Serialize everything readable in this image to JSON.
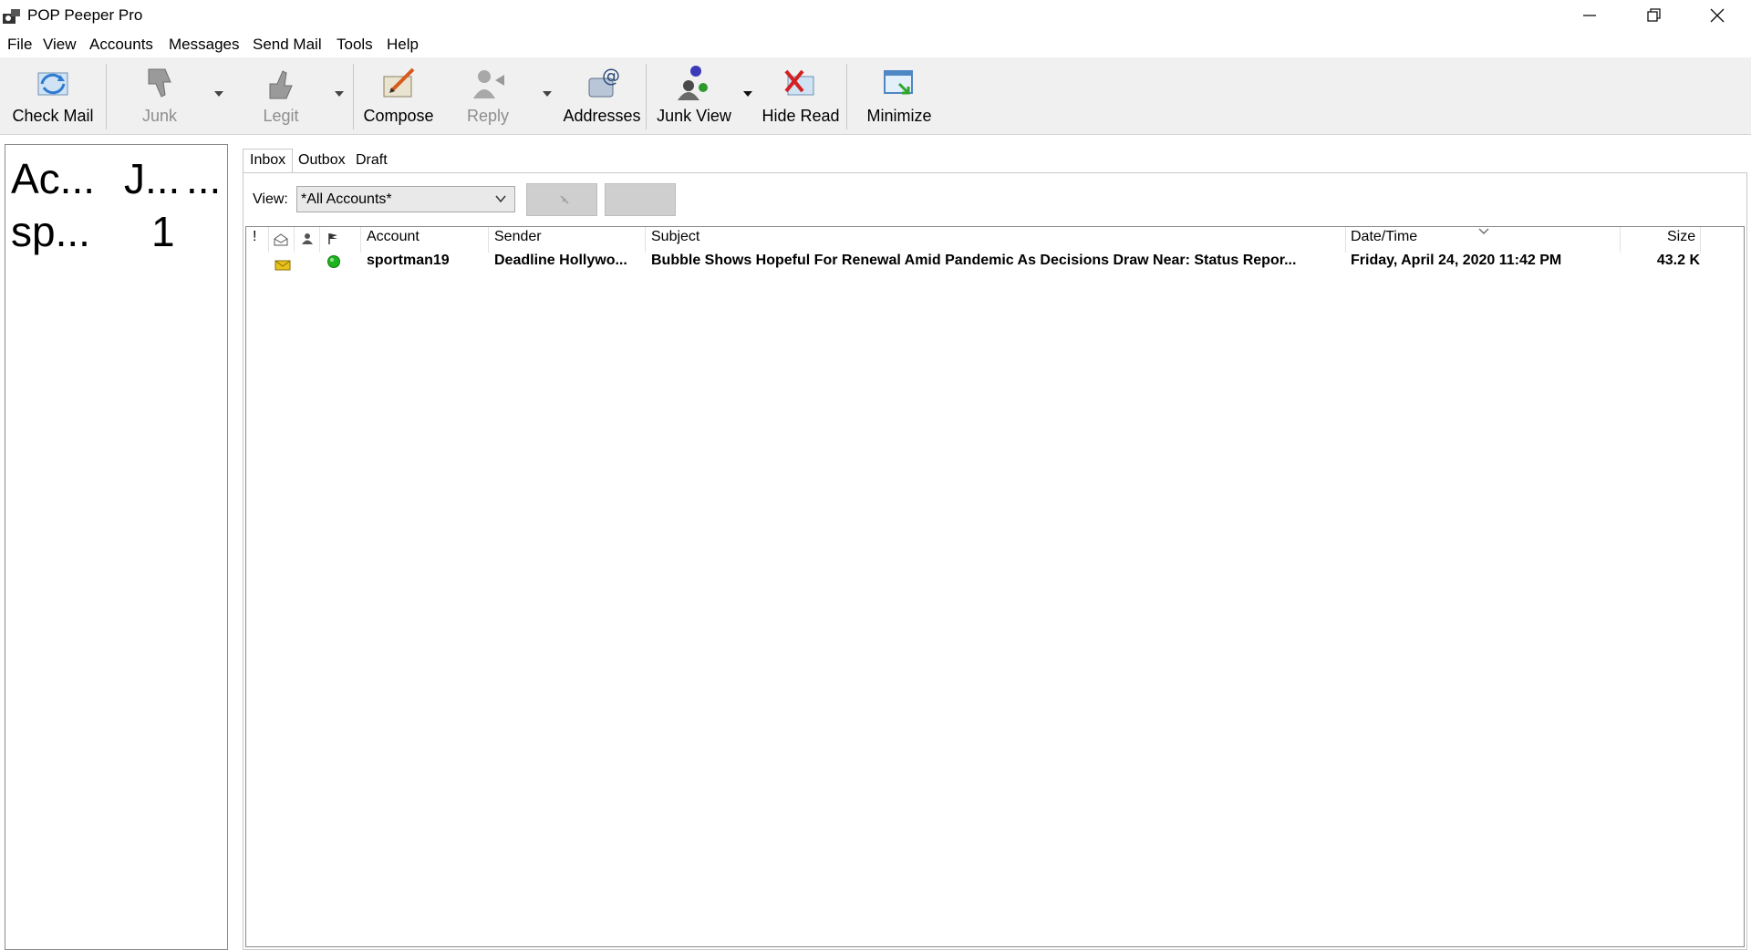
{
  "window": {
    "title": "POP Peeper Pro"
  },
  "menu": [
    "File",
    "View",
    "Accounts",
    "Messages",
    "Send Mail",
    "Tools",
    "Help"
  ],
  "toolbar": {
    "check_mail": "Check Mail",
    "junk": "Junk",
    "legit": "Legit",
    "compose": "Compose",
    "reply": "Reply",
    "addresses": "Addresses",
    "junk_view": "Junk View",
    "hide_read": "Hide Read",
    "minimize": "Minimize"
  },
  "accounts_pane": {
    "headers": [
      "Ac...",
      "J...",
      "..."
    ],
    "rows": [
      {
        "account": "sp...",
        "count": "1"
      }
    ]
  },
  "tabs": [
    "Inbox",
    "Outbox",
    "Draft"
  ],
  "view": {
    "label": "View:",
    "selected": "*All Accounts*"
  },
  "message_list": {
    "columns": {
      "priority": "!",
      "account": "Account",
      "sender": "Sender",
      "subject": "Subject",
      "datetime": "Date/Time",
      "size": "Size"
    },
    "rows": [
      {
        "account": "sportman19",
        "sender": "Deadline Hollywo...",
        "subject": "Bubble Shows Hopeful For Renewal Amid Pandemic As Decisions Draw Near: Status Repor...",
        "datetime": "Friday, April 24, 2020 11:42 PM",
        "size": "43.2 K"
      }
    ]
  },
  "colors": {
    "toolbar_bg": "#f0f0f0",
    "status_dot": "#1fb31f",
    "envelope": "#e8c21b",
    "disabled_text": "#8e8e8e"
  }
}
